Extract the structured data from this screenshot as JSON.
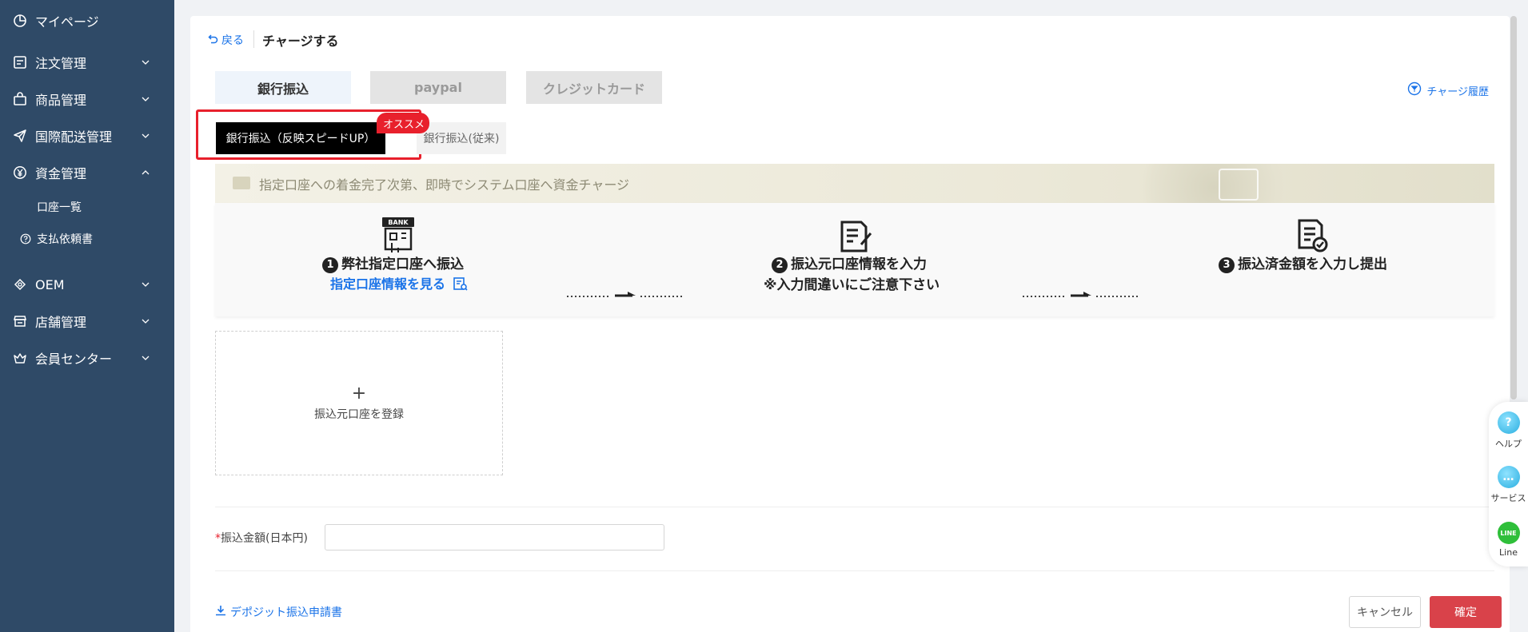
{
  "sidebar": {
    "items": [
      {
        "label": "マイページ",
        "icon": "pie-chart-icon"
      },
      {
        "label": "注文管理",
        "icon": "order-icon"
      },
      {
        "label": "商品管理",
        "icon": "shopping-bag-icon"
      },
      {
        "label": "国際配送管理",
        "icon": "send-icon"
      },
      {
        "label": "資金管理",
        "icon": "yen-icon"
      },
      {
        "label": "OEM",
        "icon": "oem-icon"
      },
      {
        "label": "店舗管理",
        "icon": "store-icon"
      },
      {
        "label": "会員センター",
        "icon": "crown-icon"
      }
    ],
    "sub_items": [
      {
        "label": "口座一覧"
      },
      {
        "label": "支払依頼書",
        "icon": "question-circle-icon"
      }
    ]
  },
  "header": {
    "back_label": "戻る",
    "title": "チャージする"
  },
  "tabs": [
    {
      "label": "銀行振込"
    },
    {
      "label": "paypal"
    },
    {
      "label": "クレジットカード"
    }
  ],
  "history_link": "チャージ履歴",
  "subtabs": {
    "primary": "銀行振込（反映スピードUP）",
    "badge": "オススメ",
    "secondary": "銀行振込(従来)"
  },
  "banner": {
    "text": "指定口座への着金完了次第、即時でシステム口座へ資金チャージ"
  },
  "steps": [
    {
      "num": "1",
      "title": "弊社指定口座へ振込",
      "link": "指定口座情報を見る",
      "icon": "bank-icon"
    },
    {
      "num": "2",
      "title": "振込元口座情報を入力",
      "sub": "※入力間違いにご注意下さい",
      "icon": "form-edit-icon"
    },
    {
      "num": "3",
      "title": "振込済金額を入力し提出",
      "icon": "document-check-icon"
    }
  ],
  "bank_icon_text": "BANK",
  "add_account": {
    "plus": "+",
    "label": "振込元口座を登録"
  },
  "amount": {
    "required_mark": "*",
    "label": "振込金額(日本円)",
    "value": ""
  },
  "footer": {
    "download_label": "デポジット振込申請書",
    "cancel_label": "キャンセル",
    "confirm_label": "確定"
  },
  "floating": {
    "help": "ヘルプ",
    "service": "サービス",
    "line": "Line",
    "line_icon_text": "LINE"
  },
  "colors": {
    "sidebar_bg": "#2f4a67",
    "link": "#1a73e8",
    "accent_red": "#e8202c",
    "confirm_bg": "#d9424a"
  }
}
